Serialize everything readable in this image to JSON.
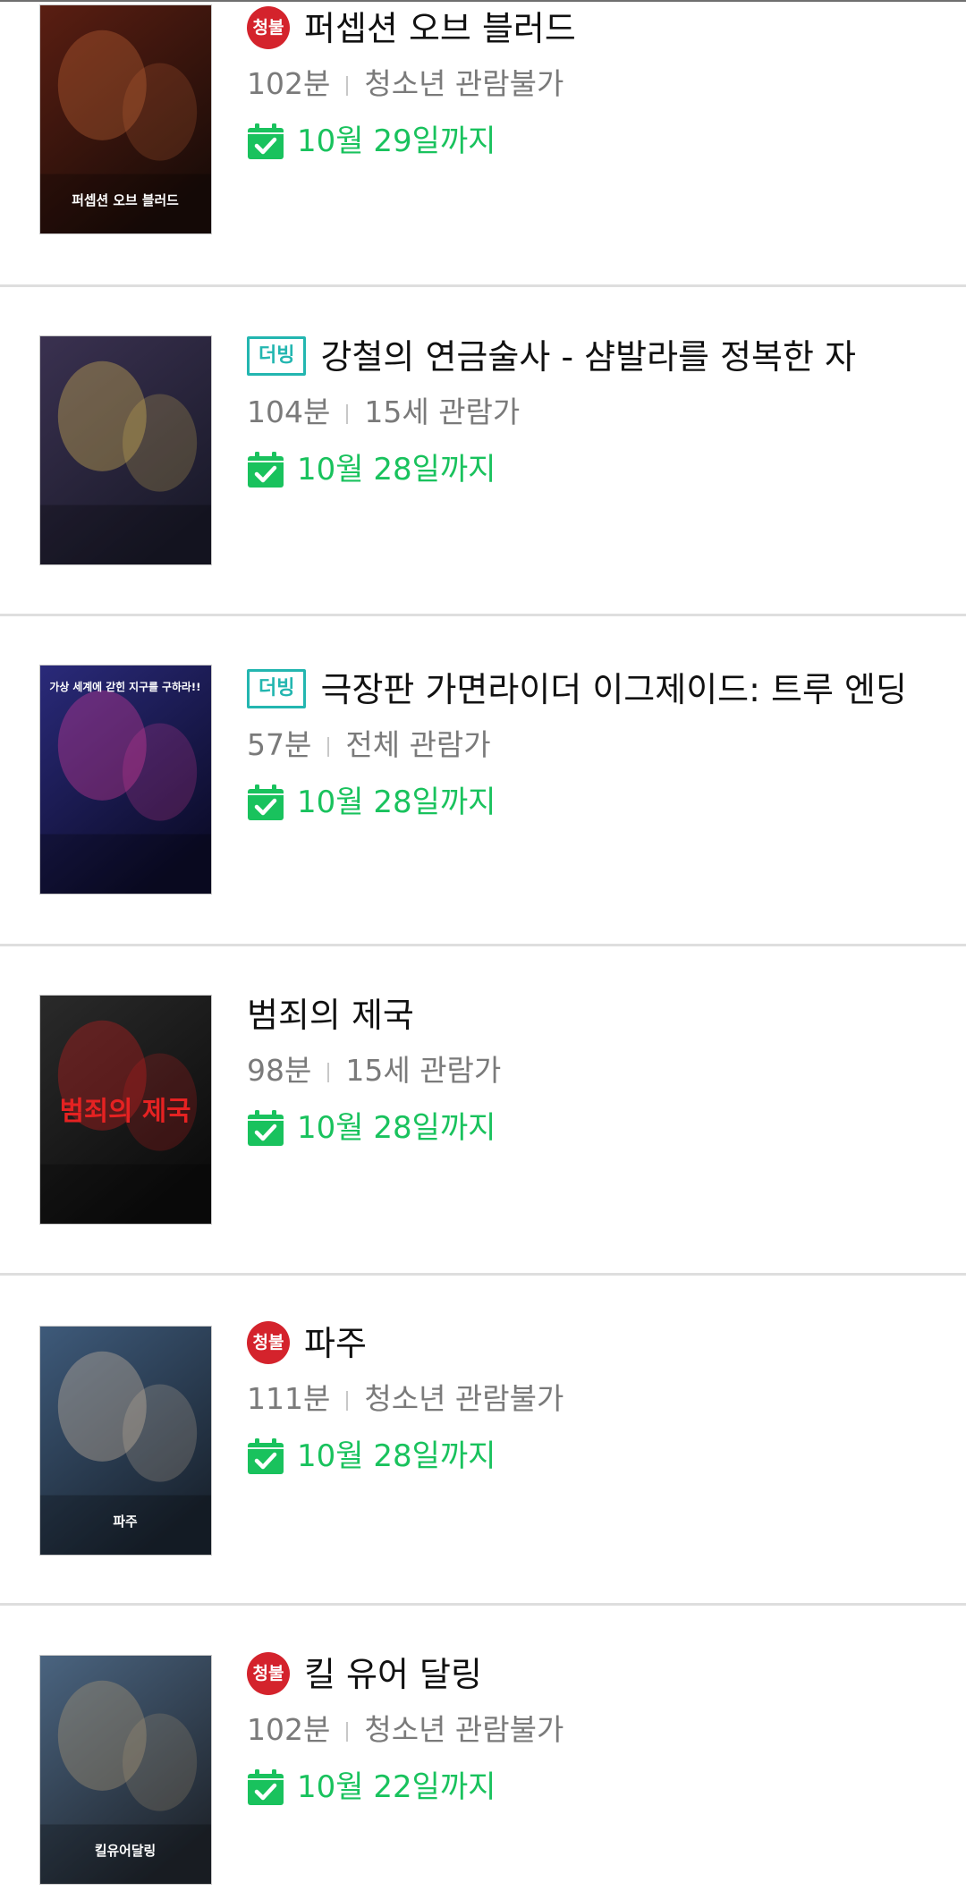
{
  "movies": [
    {
      "badge": "청불",
      "badge_type": "rating",
      "title": "퍼셉션 오브 블러드",
      "runtime": "102분",
      "rating": "청소년 관람불가",
      "until": "10월 29일까지",
      "poster_caption": "퍼셉션 오브 블러드",
      "poster_colors": [
        "#5a1e12",
        "#1b0c08",
        "#c96a3a"
      ]
    },
    {
      "badge": "더빙",
      "badge_type": "dub",
      "title": "강철의 연금술사 - 샴발라를 정복한 자",
      "runtime": "104분",
      "rating": "15세 관람가",
      "until": "10월 28일까지",
      "poster_caption": "",
      "poster_colors": [
        "#3a3150",
        "#1a1a2a",
        "#e4c45a"
      ]
    },
    {
      "badge": "더빙",
      "badge_type": "dub",
      "title": "극장판 가면라이더 이그제이드: 트루 엔딩",
      "runtime": "57분",
      "rating": "전체 관람가",
      "until": "10월 28일까지",
      "poster_caption": "가상 세계에 갇힌 지구를 구하라!!",
      "poster_colors": [
        "#2a2a7a",
        "#0c0c2a",
        "#e33fa0"
      ]
    },
    {
      "badge": "",
      "badge_type": "none",
      "title": "범죄의 제국",
      "runtime": "98분",
      "rating": "15세 관람가",
      "until": "10월 28일까지",
      "poster_caption": "범죄의 제국",
      "poster_colors": [
        "#2a2a2a",
        "#0c0c0c",
        "#d21f1f"
      ]
    },
    {
      "badge": "청불",
      "badge_type": "rating",
      "title": "파주",
      "runtime": "111분",
      "rating": "청소년 관람불가",
      "until": "10월 28일까지",
      "poster_caption": "파주",
      "poster_colors": [
        "#3e5a7a",
        "#1a2430",
        "#d9c2a8"
      ]
    },
    {
      "badge": "청불",
      "badge_type": "rating",
      "title": "킬 유어 달링",
      "runtime": "102분",
      "rating": "청소년 관람불가",
      "until": "10월 22일까지",
      "poster_caption": "킬유어달링",
      "poster_colors": [
        "#4a6480",
        "#20262e",
        "#b7a07a"
      ]
    }
  ],
  "colors": {
    "accent_green": "#19c25d",
    "rating_red": "#d4232c",
    "dub_teal": "#23b6b0",
    "meta_gray": "#7a7a7a"
  },
  "icons": {
    "calendar": "calendar-check-icon"
  }
}
